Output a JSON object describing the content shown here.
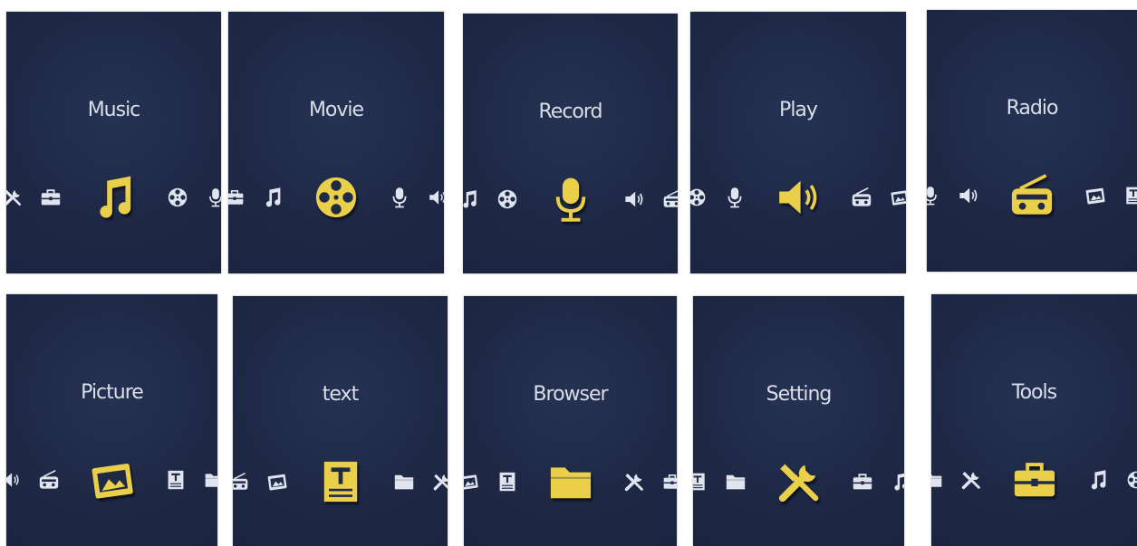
{
  "colors": {
    "panel_bg": "#1f2a47",
    "title_text": "#d9dee8",
    "selected_icon": "#e9cf4a",
    "inactive_icon": "#dfe4ee"
  },
  "screens": [
    {
      "label": "Music",
      "icons": [
        "tools-icon",
        "toolbox-icon",
        "music-note-icon",
        "film-reel-icon",
        "microphone-icon"
      ]
    },
    {
      "label": "Movie",
      "icons": [
        "toolbox-icon",
        "music-note-icon",
        "film-reel-icon",
        "microphone-icon",
        "speaker-icon"
      ]
    },
    {
      "label": "Record",
      "icons": [
        "music-note-icon",
        "film-reel-icon",
        "microphone-icon",
        "speaker-icon",
        "radio-icon"
      ]
    },
    {
      "label": "Play",
      "icons": [
        "film-reel-icon",
        "microphone-icon",
        "speaker-icon",
        "radio-icon",
        "picture-icon"
      ]
    },
    {
      "label": "Radio",
      "icons": [
        "microphone-icon",
        "speaker-icon",
        "radio-icon",
        "picture-icon",
        "text-icon"
      ]
    },
    {
      "label": "Picture",
      "icons": [
        "speaker-icon",
        "radio-icon",
        "picture-icon",
        "text-icon",
        "folder-icon"
      ]
    },
    {
      "label": "text",
      "icons": [
        "radio-icon",
        "picture-icon",
        "text-icon",
        "folder-icon",
        "tools-icon"
      ]
    },
    {
      "label": "Browser",
      "icons": [
        "picture-icon",
        "text-icon",
        "folder-icon",
        "tools-icon",
        "toolbox-icon"
      ]
    },
    {
      "label": "Setting",
      "icons": [
        "text-icon",
        "folder-icon",
        "tools-icon",
        "toolbox-icon",
        "music-note-icon"
      ]
    },
    {
      "label": "Tools",
      "icons": [
        "folder-icon",
        "tools-icon",
        "toolbox-icon",
        "music-note-icon",
        "film-reel-icon"
      ]
    }
  ]
}
